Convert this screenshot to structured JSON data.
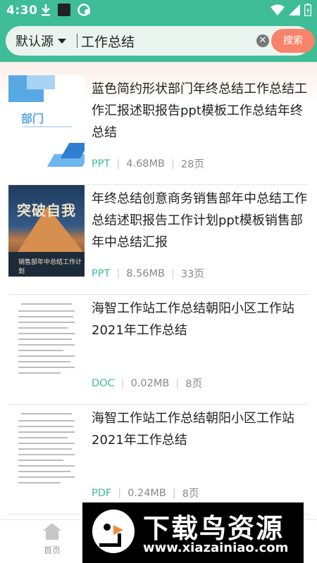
{
  "status_bar": {
    "time": "4:30",
    "left_icons": [
      "download-icon",
      "square-app-icon",
      "chat-app-icon"
    ],
    "right_icons": [
      "wifi-icon",
      "signal-icon",
      "battery-icon"
    ]
  },
  "search": {
    "source_label": "默认源",
    "query": "工作总结",
    "button_label": "搜索"
  },
  "results": [
    {
      "title": "蓝色简约形状部门年终总结工作总结工作汇报述职报告ppt模板工作总结年终总结",
      "type": "PPT",
      "size": "4.68MB",
      "pages": "28页"
    },
    {
      "title": "年终总结创意商务销售部年中总结工作总结述职报告工作计划ppt模板销售部年中总结汇报",
      "type": "PPT",
      "size": "8.56MB",
      "pages": "33页"
    },
    {
      "title": "海智工作站工作总结朝阳小区工作站2021年工作总结",
      "type": "DOC",
      "size": "0.02MB",
      "pages": "8页"
    },
    {
      "title": "海智工作站工作总结朝阳小区工作站2021年工作总结",
      "type": "PDF",
      "size": "0.24MB",
      "pages": "8页"
    }
  ],
  "thumbnails": {
    "thumb1_text": "部门",
    "thumb2_text": "突破自我",
    "thumb2_caption": "销售部年中总结工作计划"
  },
  "bottom_nav": {
    "home_label": "首页"
  },
  "watermark": {
    "title": "下载鸟资源",
    "url": "www.xiazainiao.com"
  },
  "colors": {
    "accent": "#3ebd97",
    "search_button": "#f8836b",
    "meta_type": "#3ebd97"
  }
}
